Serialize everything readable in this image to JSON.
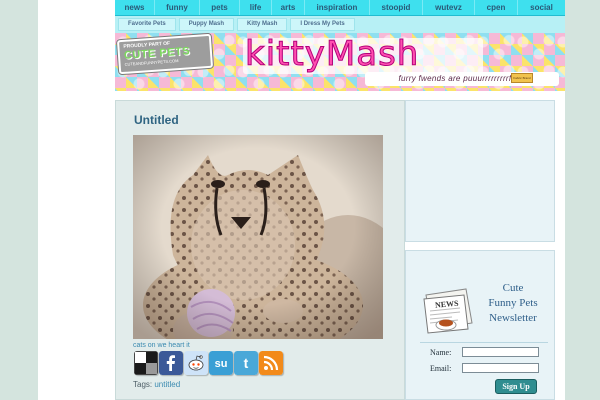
{
  "nav_primary": [
    "news",
    "funny",
    "pets",
    "life",
    "arts",
    "inspiration",
    "stoopid",
    "wutevz",
    "cpen",
    "social"
  ],
  "nav_secondary": [
    "Favorite Pets",
    "Puppy Mash",
    "Kitty Mash",
    "I Dress My Pets"
  ],
  "banner": {
    "badge_line1": "PROUDLY PART OF",
    "badge_line2": "CUTE PETS",
    "badge_line3": "CUTEANDFUNNYPETS.COM",
    "logo": "kittyMash",
    "tagline": "furry fwends are puuurrrrrrrrrfect!",
    "stamp": "Fabric Brand"
  },
  "post": {
    "title": "Untitled",
    "caption": "cats on we heart it",
    "tags_label": "Tags:",
    "tag": "untitled"
  },
  "share": [
    {
      "icon": "delicious-icon",
      "color": "#1a1a1a"
    },
    {
      "icon": "facebook-icon",
      "color": "#3b5998"
    },
    {
      "icon": "reddit-icon",
      "color": "#cee3f8"
    },
    {
      "icon": "stumbleupon-icon",
      "color": "#3a9fd5"
    },
    {
      "icon": "twitter-icon",
      "color": "#4aa8d8"
    },
    {
      "icon": "rss-icon",
      "color": "#f28a1a"
    }
  ],
  "newsletter": {
    "title_line1": "Cute",
    "title_line2": "Funny Pets",
    "title_line3": "Newsletter",
    "paper_label": "NEWS",
    "name_label": "Name:",
    "email_label": "Email:",
    "name_value": "",
    "email_value": "",
    "signup_label": "Sign Up"
  }
}
